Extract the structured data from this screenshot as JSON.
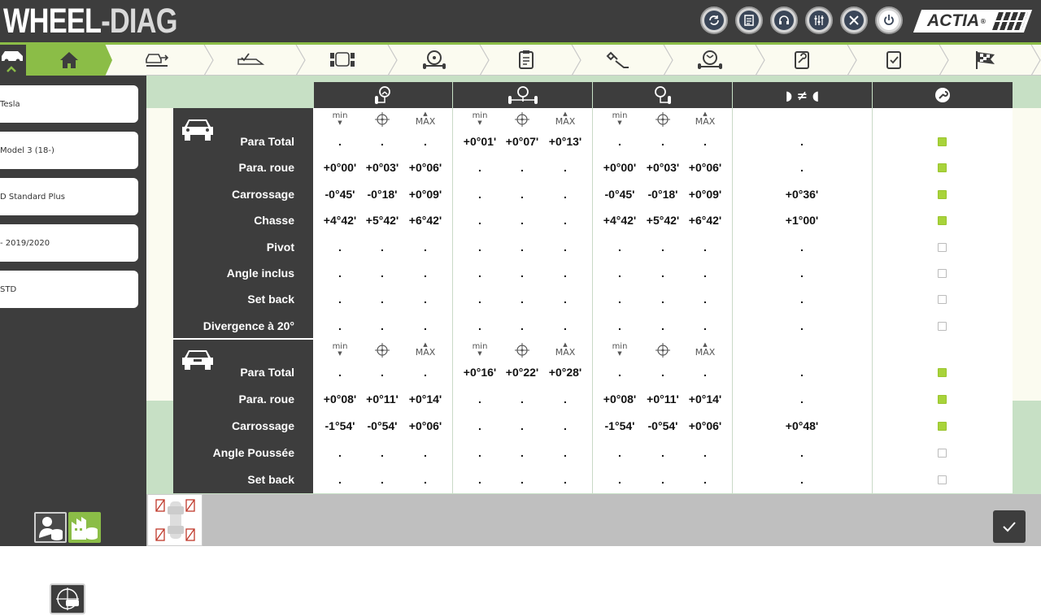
{
  "app": {
    "title_part1": "WHEEL",
    "title_part2": "-DIAG",
    "brand": "ACTIA",
    "brand_mark": "®"
  },
  "header_buttons": [
    "sync-icon",
    "document-icon",
    "headset-icon",
    "sliders-icon",
    "tools-icon",
    "power-icon"
  ],
  "nav": {
    "steps": [
      "home-icon",
      "car-lift-icon",
      "ramp-icon",
      "vehicle-sensors-icon",
      "steering-wheel-icon",
      "clipboard-icon",
      "wrench-adjust-icon",
      "wheel-alignment-icon",
      "document-tool-icon",
      "checklist-icon",
      "finish-flag-icon"
    ]
  },
  "vehicle": {
    "make": "Tesla",
    "model": "Model 3 (18-)",
    "version": "D Standard Plus",
    "years": "-  2019/2020",
    "option": "STD"
  },
  "table": {
    "col_heads": [
      "steering-axle-icon",
      "steering-frame-icon",
      "rear-axle-icon",
      "difference-icon",
      "wrench-icon"
    ],
    "diff_symbol": "≠",
    "sub_labels": {
      "min": "min",
      "center": "target-icon",
      "max": "MAX"
    },
    "front": {
      "rows": [
        {
          "label": "Para Total",
          "v": [
            ".",
            ".",
            ".",
            "+0°01'",
            "+0°07'",
            "+0°13'",
            ".",
            ".",
            ".",
            "."
          ],
          "check": true
        },
        {
          "label": "Para. roue",
          "v": [
            "+0°00'",
            "+0°03'",
            "+0°06'",
            ".",
            ".",
            ".",
            "+0°00'",
            "+0°03'",
            "+0°06'",
            "."
          ],
          "check": true
        },
        {
          "label": "Carrossage",
          "v": [
            "-0°45'",
            "-0°18'",
            "+0°09'",
            ".",
            ".",
            ".",
            "-0°45'",
            "-0°18'",
            "+0°09'",
            "+0°36'"
          ],
          "check": true
        },
        {
          "label": "Chasse",
          "v": [
            "+4°42'",
            "+5°42'",
            "+6°42'",
            ".",
            ".",
            ".",
            "+4°42'",
            "+5°42'",
            "+6°42'",
            "+1°00'"
          ],
          "check": true
        },
        {
          "label": "Pivot",
          "v": [
            ".",
            ".",
            ".",
            ".",
            ".",
            ".",
            ".",
            ".",
            ".",
            "."
          ],
          "check": false
        },
        {
          "label": "Angle inclus",
          "v": [
            ".",
            ".",
            ".",
            ".",
            ".",
            ".",
            ".",
            ".",
            ".",
            "."
          ],
          "check": false
        },
        {
          "label": "Set back",
          "v": [
            ".",
            ".",
            ".",
            ".",
            ".",
            ".",
            ".",
            ".",
            ".",
            "."
          ],
          "check": false
        },
        {
          "label": "Divergence à 20°",
          "v": [
            ".",
            ".",
            ".",
            ".",
            ".",
            ".",
            ".",
            ".",
            ".",
            "."
          ],
          "check": false
        }
      ]
    },
    "rear": {
      "rows": [
        {
          "label": "Para Total",
          "v": [
            ".",
            ".",
            ".",
            "+0°16'",
            "+0°22'",
            "+0°28'",
            ".",
            ".",
            ".",
            "."
          ],
          "check": true
        },
        {
          "label": "Para. roue",
          "v": [
            "+0°08'",
            "+0°11'",
            "+0°14'",
            ".",
            ".",
            ".",
            "+0°08'",
            "+0°11'",
            "+0°14'",
            "."
          ],
          "check": true
        },
        {
          "label": "Carrossage",
          "v": [
            "-1°54'",
            "-0°54'",
            "+0°06'",
            ".",
            ".",
            ".",
            "-1°54'",
            "-0°54'",
            "+0°06'",
            "+0°48'"
          ],
          "check": true
        },
        {
          "label": "Angle Poussée",
          "v": [
            ".",
            ".",
            ".",
            ".",
            ".",
            ".",
            ".",
            ".",
            ".",
            "."
          ],
          "check": false
        },
        {
          "label": "Set back",
          "v": [
            ".",
            ".",
            ".",
            ".",
            ".",
            ".",
            ".",
            ".",
            ".",
            "."
          ],
          "check": false
        }
      ]
    }
  },
  "footer": {
    "confirm": "check-icon"
  }
}
